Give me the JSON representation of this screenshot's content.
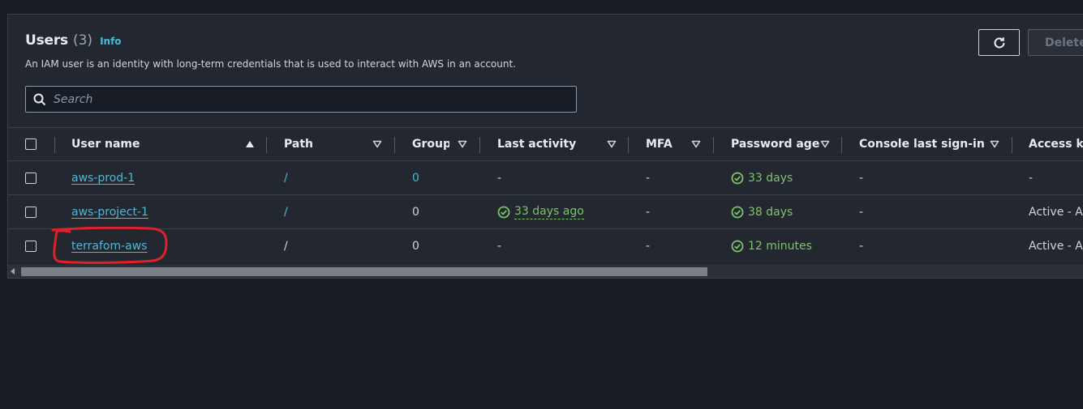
{
  "header": {
    "title": "Users",
    "count": "(3)",
    "info_label": "Info",
    "description": "An IAM user is an identity with long-term credentials that is used to interact with AWS in an account."
  },
  "search": {
    "placeholder": "Search",
    "value": ""
  },
  "actions": {
    "refresh_icon": "refresh-icon",
    "delete_label": "Delete"
  },
  "table": {
    "columns": [
      "User name",
      "Path",
      "Groups",
      "Last activity",
      "MFA",
      "Password age",
      "Console last sign-in",
      "Access key"
    ],
    "rows": [
      {
        "user_name": "aws-prod-1",
        "path": "/",
        "groups": "0",
        "last_activity": "-",
        "mfa": "-",
        "password_age": "33 days",
        "console_last_signin": "-",
        "access_key": "-"
      },
      {
        "user_name": "aws-project-1",
        "path": "/",
        "groups": "0",
        "last_activity": "33 days ago",
        "mfa": "-",
        "password_age": "38 days",
        "console_last_signin": "-",
        "access_key": "Active - AKIA"
      },
      {
        "user_name": "terrafom-aws",
        "path": "/",
        "groups": "0",
        "last_activity": "-",
        "mfa": "-",
        "password_age": "12 minutes",
        "console_last_signin": "-",
        "access_key": "Active - AKIA"
      }
    ]
  },
  "colors": {
    "link": "#4bb8d8",
    "success": "#7ec26a",
    "annotation": "#e0202a",
    "background": "#181c24",
    "panel": "#232830"
  }
}
